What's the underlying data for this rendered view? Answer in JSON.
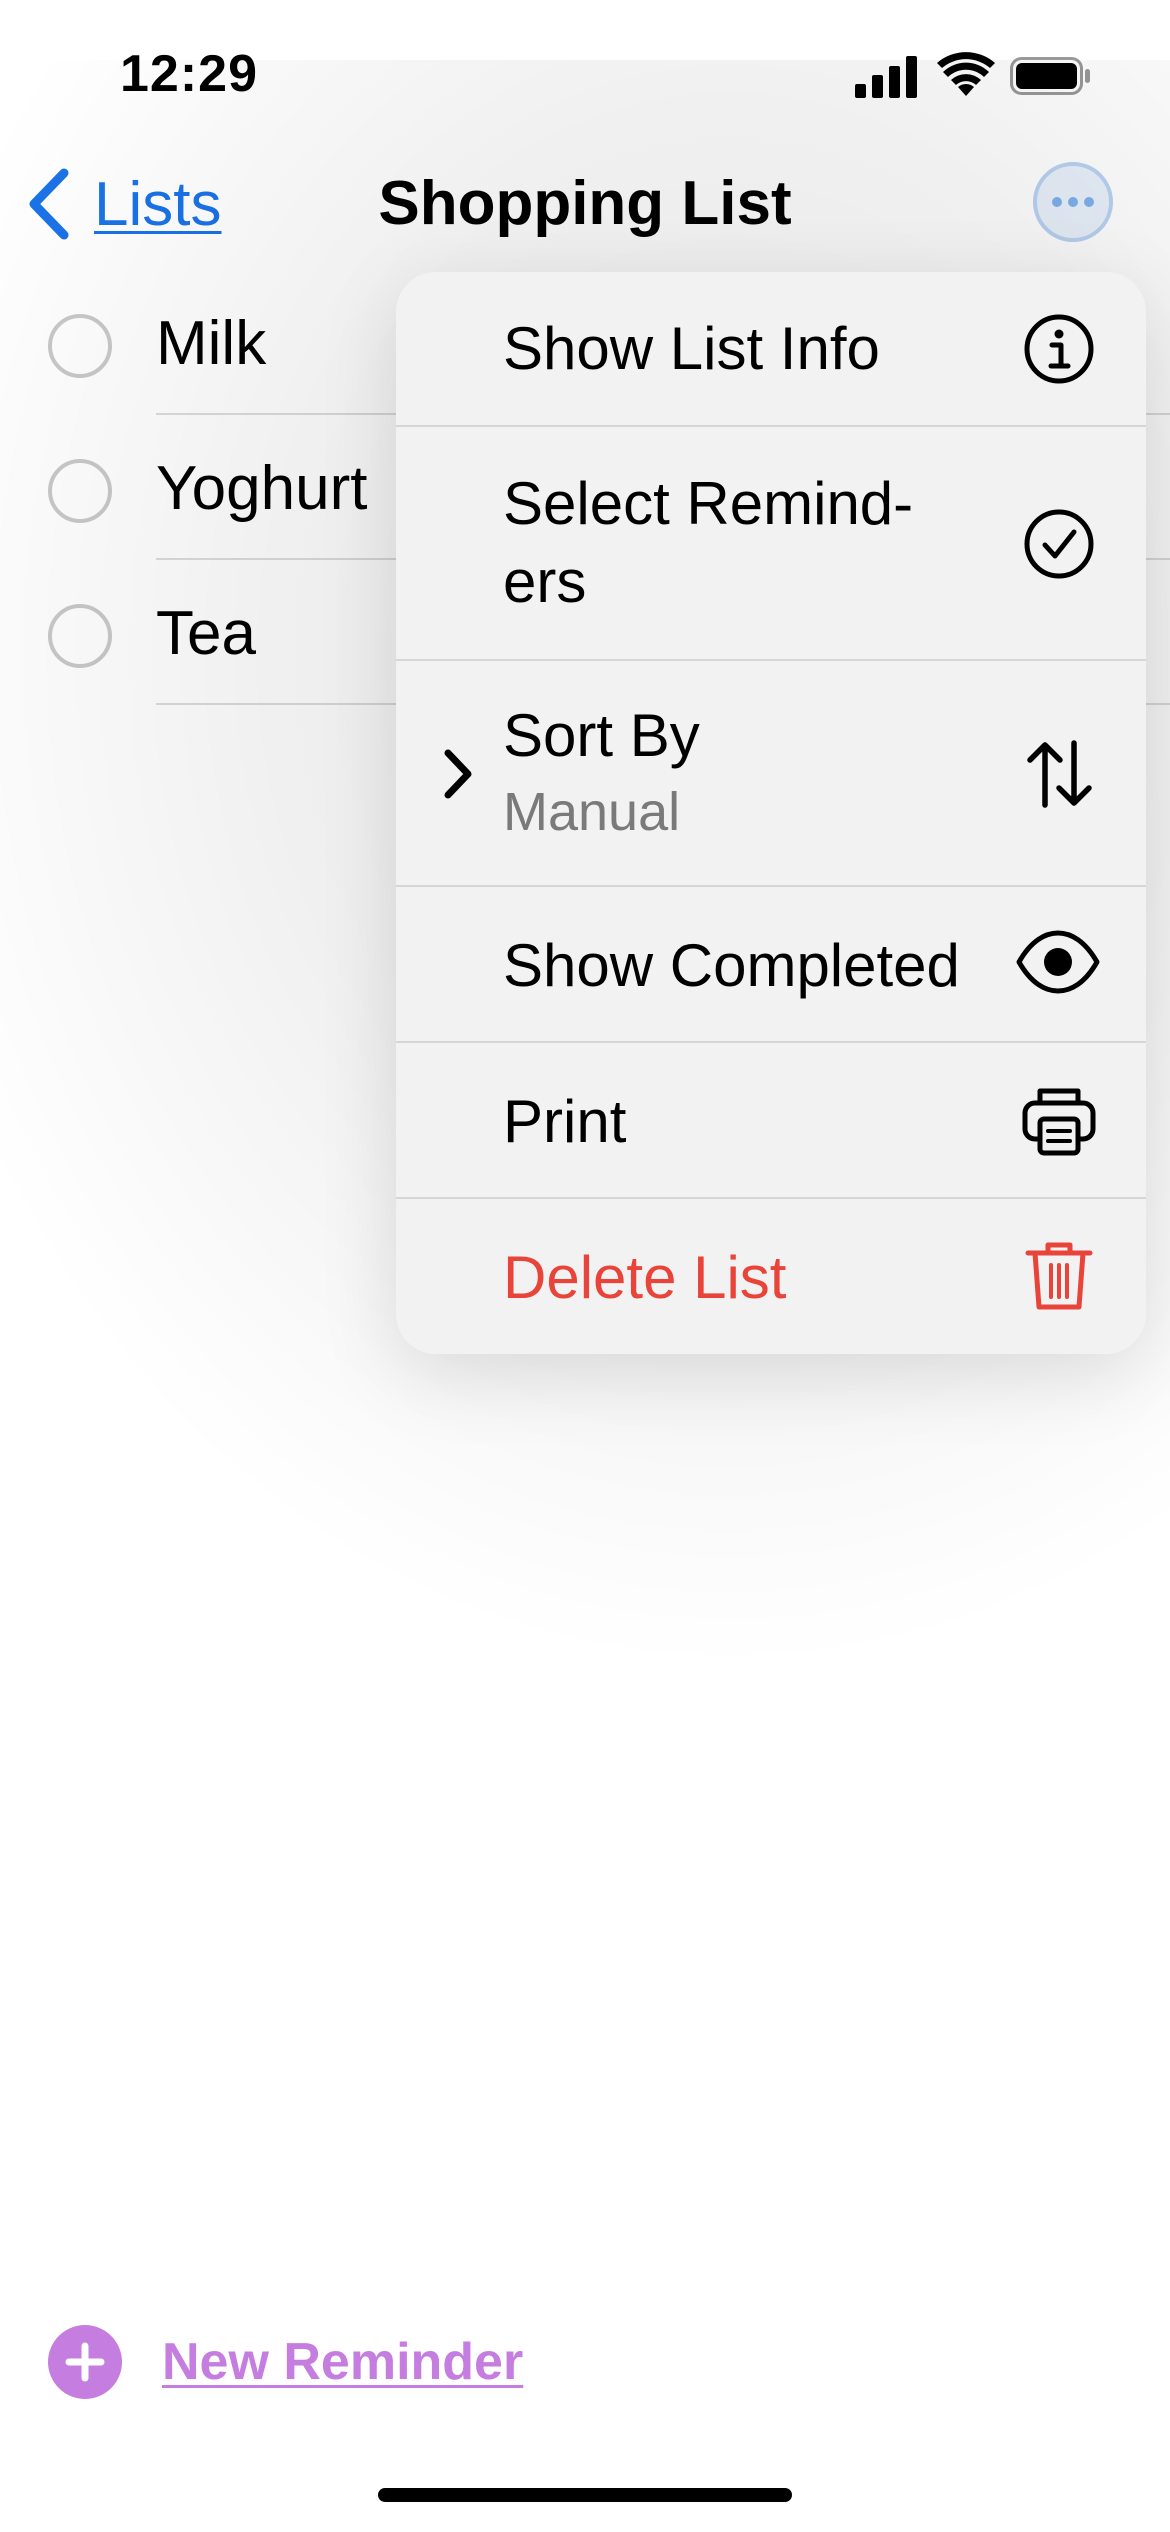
{
  "status_bar": {
    "time": "12:29"
  },
  "nav": {
    "back_label": "Lists",
    "title": "Shopping List",
    "more_icon": "ellipsis-circle-icon"
  },
  "reminders": [
    {
      "title": "Milk",
      "completed": false
    },
    {
      "title": "Yoghurt",
      "completed": false
    },
    {
      "title": "Tea",
      "completed": false
    }
  ],
  "menu": {
    "items": [
      {
        "label": "Show List Info",
        "icon": "info-circle-icon"
      },
      {
        "label_line1": "Select Remind-",
        "label_line2": "ers",
        "icon": "checkmark-circle-icon"
      },
      {
        "label": "Sort By",
        "sublabel": "Manual",
        "icon": "sort-arrows-icon",
        "has_submenu": true
      },
      {
        "label": "Show Completed",
        "icon": "eye-icon"
      },
      {
        "label": "Print",
        "icon": "printer-icon"
      },
      {
        "label": "Delete List",
        "icon": "trash-icon",
        "destructive": true
      }
    ]
  },
  "bottom": {
    "new_reminder_label": "New Reminder"
  },
  "colors": {
    "accent_blue": "#1a73e8",
    "list_color": "#c57ee0",
    "destructive": "#e8443a"
  }
}
